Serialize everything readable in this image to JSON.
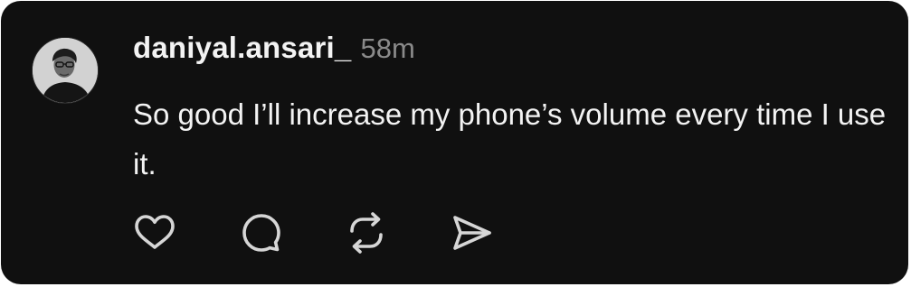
{
  "post": {
    "username": "daniyal.ansari_",
    "timestamp": "58m",
    "text": "So good I’ll increase my phone’s volume every time I use it."
  },
  "actions": [
    {
      "icon": "heart-icon"
    },
    {
      "icon": "comment-icon"
    },
    {
      "icon": "repost-icon"
    },
    {
      "icon": "share-icon"
    }
  ],
  "colors": {
    "card_background": "#101010",
    "primary_text": "#f3f3f3",
    "secondary_text": "#8a8a8a",
    "icon": "#d6d6d6"
  }
}
